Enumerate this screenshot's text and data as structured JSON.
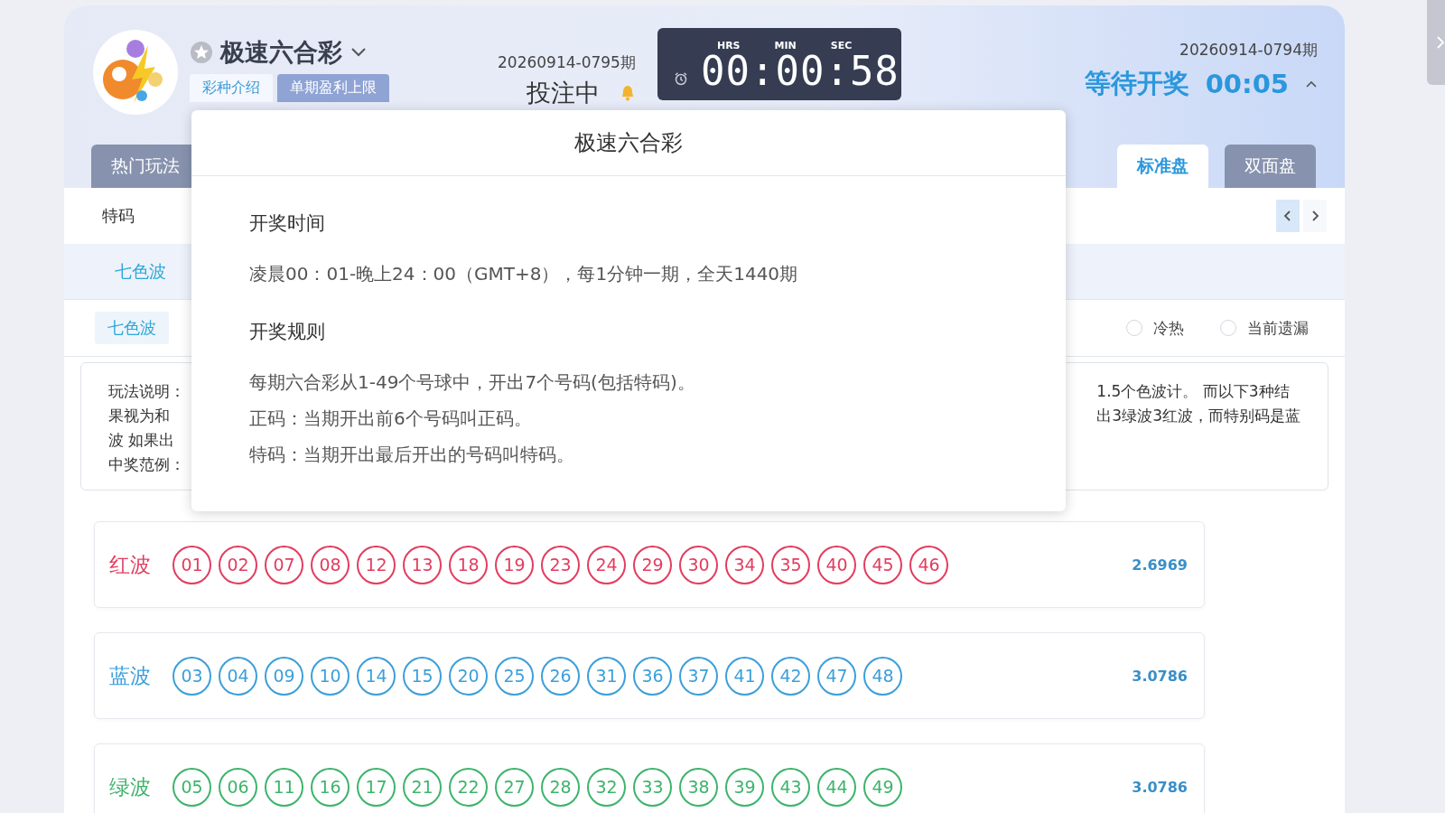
{
  "header": {
    "title": "极速六合彩",
    "subtabs": [
      {
        "label": "彩种介绍",
        "selected": true
      },
      {
        "label": "单期盈利上限",
        "selected": false
      }
    ],
    "current": {
      "issue": "20260914-0795期",
      "status": "投注中"
    },
    "timer": {
      "labels": [
        "HRS",
        "MIN",
        "SEC"
      ],
      "time": "00:00:58"
    },
    "previous": {
      "issue": "20260914-0794期",
      "status": "等待开奖",
      "countdown": "00:05"
    }
  },
  "play_tabs": [
    {
      "label": "热门玩法",
      "selected": false
    }
  ],
  "market_tabs": [
    {
      "label": "标准盘",
      "selected": true
    },
    {
      "label": "双面盘",
      "selected": false
    }
  ],
  "categories": [
    {
      "label": "特码",
      "selected": false
    }
  ],
  "subcategories": [
    {
      "label": "七色波",
      "selected": true
    }
  ],
  "chip": {
    "label": "七色波"
  },
  "options": [
    {
      "label": "冷热",
      "checked": false
    },
    {
      "label": "当前遗漏",
      "checked": false
    }
  ],
  "info_left": [
    "玩法说明：",
    "果视为和",
    "波 如果出",
    "中奖范例："
  ],
  "info_right": [
    "1.5个色波计。 而以下3种结",
    "出3绿波3红波，而特别码是蓝"
  ],
  "popup": {
    "title": "极速六合彩",
    "sections": [
      {
        "heading": "开奖时间",
        "lines": [
          "凌晨00：01-晚上24：00（GMT+8），每1分钟一期，全天1440期"
        ]
      },
      {
        "heading": "开奖规则",
        "lines": [
          "每期六合彩从1-49个号球中，开出7个号码(包括特码)。",
          "正码：当期开出前6个号码叫正码。",
          "特码：当期开出最后开出的号码叫特码。"
        ]
      }
    ]
  },
  "waves": [
    {
      "label": "红波",
      "color": "#e23d5f",
      "numbers": [
        "01",
        "02",
        "07",
        "08",
        "12",
        "13",
        "18",
        "19",
        "23",
        "24",
        "29",
        "30",
        "34",
        "35",
        "40",
        "45",
        "46"
      ],
      "odds": "2.6969"
    },
    {
      "label": "蓝波",
      "color": "#3c9fd9",
      "numbers": [
        "03",
        "04",
        "09",
        "10",
        "14",
        "15",
        "20",
        "25",
        "26",
        "31",
        "36",
        "37",
        "41",
        "42",
        "47",
        "48"
      ],
      "odds": "3.0786"
    },
    {
      "label": "绿波",
      "color": "#3db46b",
      "numbers": [
        "05",
        "06",
        "11",
        "16",
        "17",
        "21",
        "22",
        "27",
        "28",
        "32",
        "33",
        "38",
        "39",
        "43",
        "44",
        "49"
      ],
      "odds": "3.0786"
    }
  ]
}
